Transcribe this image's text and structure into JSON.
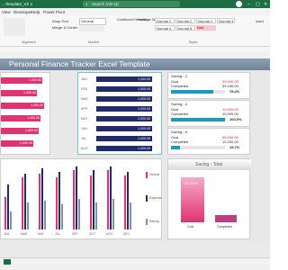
{
  "window": {
    "title": "...Template_V2 ∨",
    "search_placeholder": "Search (Alt+Q)"
  },
  "menu": [
    "View",
    "Developer",
    "Help",
    "Power Pivot"
  ],
  "ribbon": {
    "wrap_text": "Wrap Text",
    "merge_center": "Merge & Center",
    "number_format": "General",
    "alignment_label": "Alignment",
    "number_label": "Number",
    "styles_label": "Styles",
    "conditional_formatting": "Conditional Formatting",
    "format_as_table": "Format as Table",
    "insert": "Insert",
    "styles": [
      "Normal 2",
      "Normal 2 2",
      "Normal 2 3",
      "Normal 3",
      "Normal 4",
      "Normal 5",
      "Bad"
    ]
  },
  "dashboard": {
    "title": "Personal Finance Tracker Excel Template",
    "monthly_bars": {
      "months": [
        "JAN",
        "FEB",
        "MAR",
        "APR",
        "MAY",
        "JUN",
        "JUL",
        "AUG"
      ],
      "values": [
        "1,000.00",
        "1,000.00",
        "1,000.00",
        "1,000.00",
        "1,000.00",
        "1,000.00",
        "1,000.00",
        "1,000.00"
      ],
      "left_values": [
        "1,000.00",
        "1,000.00",
        "1,000.00",
        "1,000.00",
        "1,000.00",
        "1,000.00"
      ]
    },
    "savings": [
      {
        "title": "Saving - 2",
        "goal_label": "Goal",
        "goal": "50.000,00",
        "completed_label": "Completed",
        "completed": "39.180,00",
        "pct": "78,4%",
        "fill": 0.78
      },
      {
        "title": "Saving - 4",
        "goal_label": "Goal",
        "goal": "10.000,00",
        "completed_label": "Completed",
        "completed": "10.200,00",
        "pct": "100,0%",
        "fill": 1.0
      },
      {
        "title": "Saving - 6",
        "goal_label": "Goal",
        "goal": "65.000,00",
        "completed_label": "Completed",
        "completed": "10.200,00",
        "pct": "15,7%",
        "fill": 0.16
      }
    ],
    "saving_total": {
      "title": "Saving - Total",
      "goal_label": "Goal",
      "completed_label": "Completed",
      "goal_value": "135.000,00",
      "completed_value": "...",
      "completed_fraction": 0.15
    },
    "column_chart": {
      "months": [
        "JAN",
        "MAR",
        "MAY",
        "JUL",
        "SEP",
        "OCT",
        "NOV",
        "DEC"
      ],
      "legend": [
        "Income",
        "Expense",
        "Saving"
      ]
    }
  },
  "colors": {
    "pink": "#e0336f",
    "navy": "#232a6a",
    "teal": "#1a9bbd",
    "excel_green": "#1e6e43",
    "banner": "#7d90a6"
  }
}
